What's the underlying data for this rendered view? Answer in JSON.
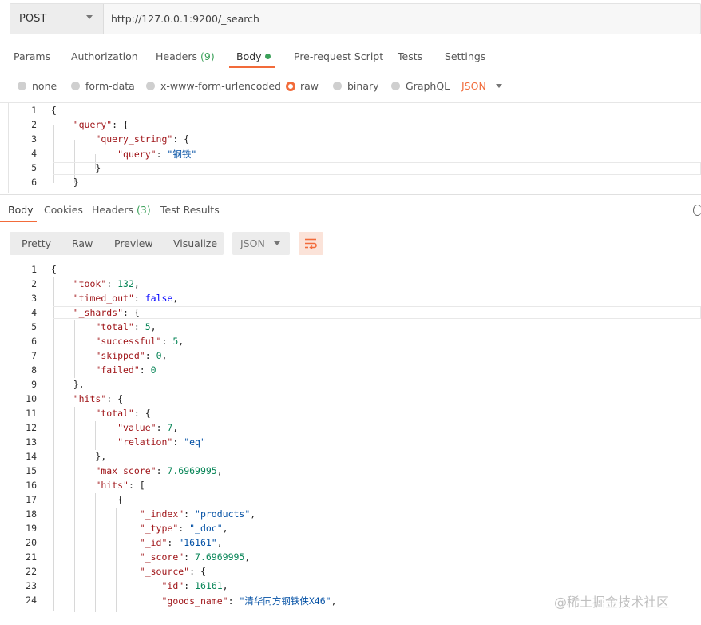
{
  "request": {
    "method": "POST",
    "url": "http://127.0.0.1:9200/_search"
  },
  "request_tabs": [
    {
      "label": "Params"
    },
    {
      "label": "Authorization"
    },
    {
      "label": "Headers",
      "count": "(9)"
    },
    {
      "label": "Body"
    },
    {
      "label": "Pre-request Script"
    },
    {
      "label": "Tests"
    },
    {
      "label": "Settings"
    }
  ],
  "body_types": [
    "none",
    "form-data",
    "x-www-form-urlencoded",
    "raw",
    "binary",
    "GraphQL"
  ],
  "body_format": "JSON",
  "request_line_numbers": [
    "1",
    "2",
    "3",
    "4",
    "5",
    "6"
  ],
  "response_tabs": [
    {
      "label": "Body"
    },
    {
      "label": "Cookies"
    },
    {
      "label": "Headers",
      "count": "(3)"
    },
    {
      "label": "Test Results"
    }
  ],
  "view_modes": [
    "Pretty",
    "Raw",
    "Preview",
    "Visualize"
  ],
  "response_format": "JSON",
  "response_line_numbers": [
    "1",
    "2",
    "3",
    "4",
    "5",
    "6",
    "7",
    "8",
    "9",
    "10",
    "11",
    "12",
    "13",
    "14",
    "15",
    "16",
    "17",
    "18",
    "19",
    "20",
    "21",
    "22",
    "23",
    "24"
  ],
  "json": {
    "query": "\"query\"",
    "query_string": "\"query_string\"",
    "inner_query": "\"query\"",
    "inner_query_value": "\"钢铁\"",
    "took": "\"took\"",
    "took_val": "132",
    "timed_out": "\"timed_out\"",
    "timed_out_val": "false",
    "shards": "\"_shards\"",
    "total": "\"total\"",
    "total_val": "5",
    "successful": "\"successful\"",
    "successful_val": "5",
    "skipped": "\"skipped\"",
    "skipped_val": "0",
    "failed": "\"failed\"",
    "failed_val": "0",
    "hits": "\"hits\"",
    "hits_total": "\"total\"",
    "value": "\"value\"",
    "value_val": "7",
    "relation": "\"relation\"",
    "relation_val": "\"eq\"",
    "max_score": "\"max_score\"",
    "max_score_val": "7.6969995",
    "hits_arr": "\"hits\"",
    "index": "\"_index\"",
    "index_val": "\"products\"",
    "type": "\"_type\"",
    "type_val": "\"_doc\"",
    "id": "\"_id\"",
    "id_val": "\"16161\"",
    "score": "\"_score\"",
    "score_val": "7.6969995",
    "source": "\"_source\"",
    "src_id": "\"id\"",
    "src_id_val": "16161",
    "goods_name": "\"goods_name\"",
    "goods_name_val": "\"清华同方钢铁侠X46\""
  },
  "watermark": "@稀土掘金技术社区",
  "colors": {
    "accent": "#f26b3a",
    "status_green": "#3ca15a"
  }
}
